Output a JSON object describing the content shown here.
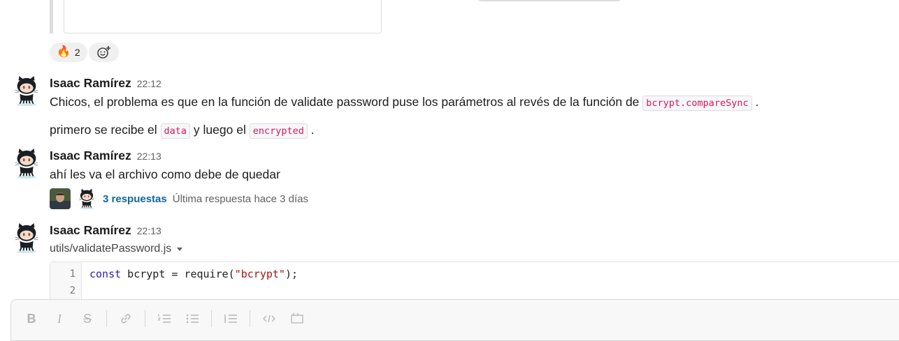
{
  "top_reaction": {
    "emoji": "🔥",
    "count": "2"
  },
  "messages": [
    {
      "author": "Isaac Ramírez",
      "time": "22:12",
      "line1": {
        "pre": "Chicos, el problema es que en la función de validate password puse los parámetros al revés de la función de ",
        "code": "bcrypt.compareSync",
        "post": " ."
      },
      "line2": {
        "pre": "primero se recibe el ",
        "code1": "data",
        "mid": " y luego el ",
        "code2": "encrypted",
        "post": " ."
      }
    },
    {
      "author": "Isaac Ramírez",
      "time": "22:13",
      "text": "ahí les va el archivo como debe de quedar",
      "thread": {
        "replies": "3 respuestas",
        "last": "Última respuesta hace 3 días"
      }
    },
    {
      "author": "Isaac Ramírez",
      "time": "22:13",
      "file_name": "utils/validatePassword.js",
      "code_lines": [
        {
          "num": "1",
          "kw": "const",
          "ident": " bcrypt = require(",
          "str": "\"bcrypt\"",
          "end": ");"
        },
        {
          "num": "2"
        }
      ]
    }
  ],
  "composer_tools": [
    "bold-icon",
    "italic-icon",
    "strikethrough-icon",
    "link-icon",
    "ordered-list-icon",
    "bulleted-list-icon",
    "blockquote-icon",
    "code-icon",
    "code-block-icon"
  ]
}
